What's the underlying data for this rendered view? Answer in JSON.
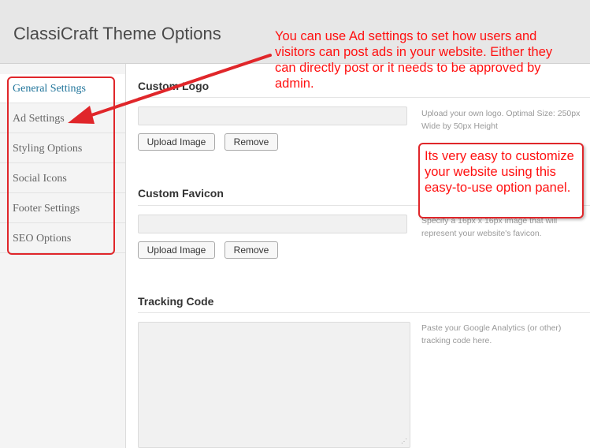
{
  "header": {
    "title": "ClassiCraft Theme Options"
  },
  "sidebar": {
    "items": [
      {
        "label": "General Settings",
        "active": true
      },
      {
        "label": "Ad Settings",
        "active": false
      },
      {
        "label": "Styling Options",
        "active": false
      },
      {
        "label": "Social Icons",
        "active": false
      },
      {
        "label": "Footer Settings",
        "active": false
      },
      {
        "label": "SEO Options",
        "active": false
      }
    ]
  },
  "main": {
    "logo": {
      "title": "Custom Logo",
      "upload_label": "Upload Image",
      "remove_label": "Remove",
      "description": "Upload your own logo. Optimal Size: 250px Wide by 50px Height"
    },
    "favicon": {
      "title": "Custom Favicon",
      "upload_label": "Upload Image",
      "remove_label": "Remove",
      "description": "Specify a 16px x 16px image that will represent your website's favicon."
    },
    "tracking": {
      "title": "Tracking Code",
      "description": "Paste your Google Analytics (or other) tracking code here."
    }
  },
  "annotations": {
    "ad_settings_note": "You can use Ad settings to set how users and visitors can post ads in your website. Either they can directly post or it needs to be approved by admin.",
    "ease_note": "Its very easy to customize your website using this easy-to-use option panel."
  },
  "colors": {
    "accent": "#21759b",
    "annotation": "#ff1010"
  }
}
